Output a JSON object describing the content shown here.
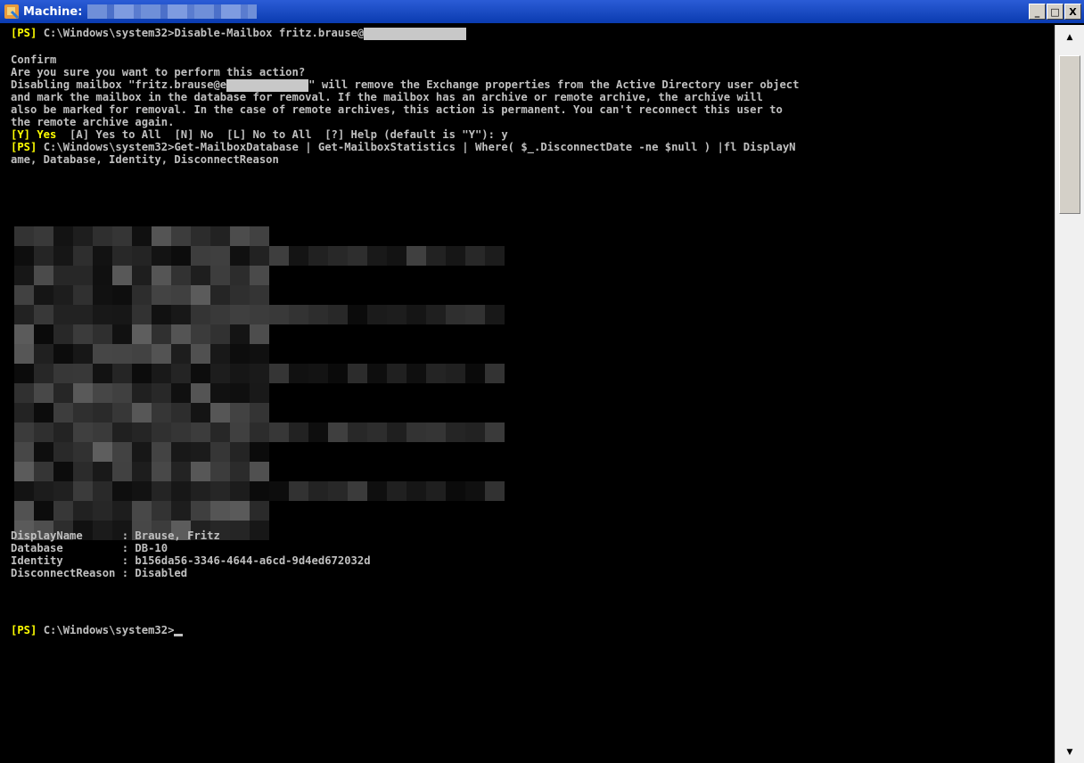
{
  "window": {
    "title": "Machine:",
    "minimize_label": "_",
    "restore_label": "□",
    "close_label": "X"
  },
  "console": {
    "line1_prompt": "[PS]",
    "line1_cmd": " C:\\Windows\\system32>Disable-Mailbox fritz.brause@",
    "confirm": "Confirm",
    "question": "Are you sure you want to perform this action?",
    "msg1_a": "Disabling mailbox \"fritz.brause@e",
    "msg1_b": "\" will remove the Exchange properties from the Active Directory user object",
    "msg2": "and mark the mailbox in the database for removal. If the mailbox has an archive or remote archive, the archive will",
    "msg3": "also be marked for removal. In the case of remote archives, this action is permanent. You can't reconnect this user to",
    "msg4": "the remote archive again.",
    "opt_yes": "[Y] Yes",
    "opt_rest": "  [A] Yes to All  [N] No  [L] No to All  [?] Help (default is \"Y\"): y",
    "line2_prompt": "[PS]",
    "line2_cmd": " C:\\Windows\\system32>Get-MailboxDatabase | Get-MailboxStatistics | Where( $_.DisconnectDate -ne $null ) |fl DisplayN",
    "line3": "ame, Database, Identity, DisconnectReason",
    "r1": "DisplayName      : Brause, Fritz",
    "r2": "Database         : DB-10",
    "r3": "Identity         : b156da56-3346-4644-a6cd-9d4ed672032d",
    "r4": "DisconnectReason : Disabled",
    "final_prompt": "[PS]",
    "final_path": " C:\\Windows\\system32>"
  },
  "colors": {
    "background": "#000000",
    "text": "#c0c0c0",
    "prompt": "#ffff00",
    "titlebar": "#0a3bb0"
  }
}
